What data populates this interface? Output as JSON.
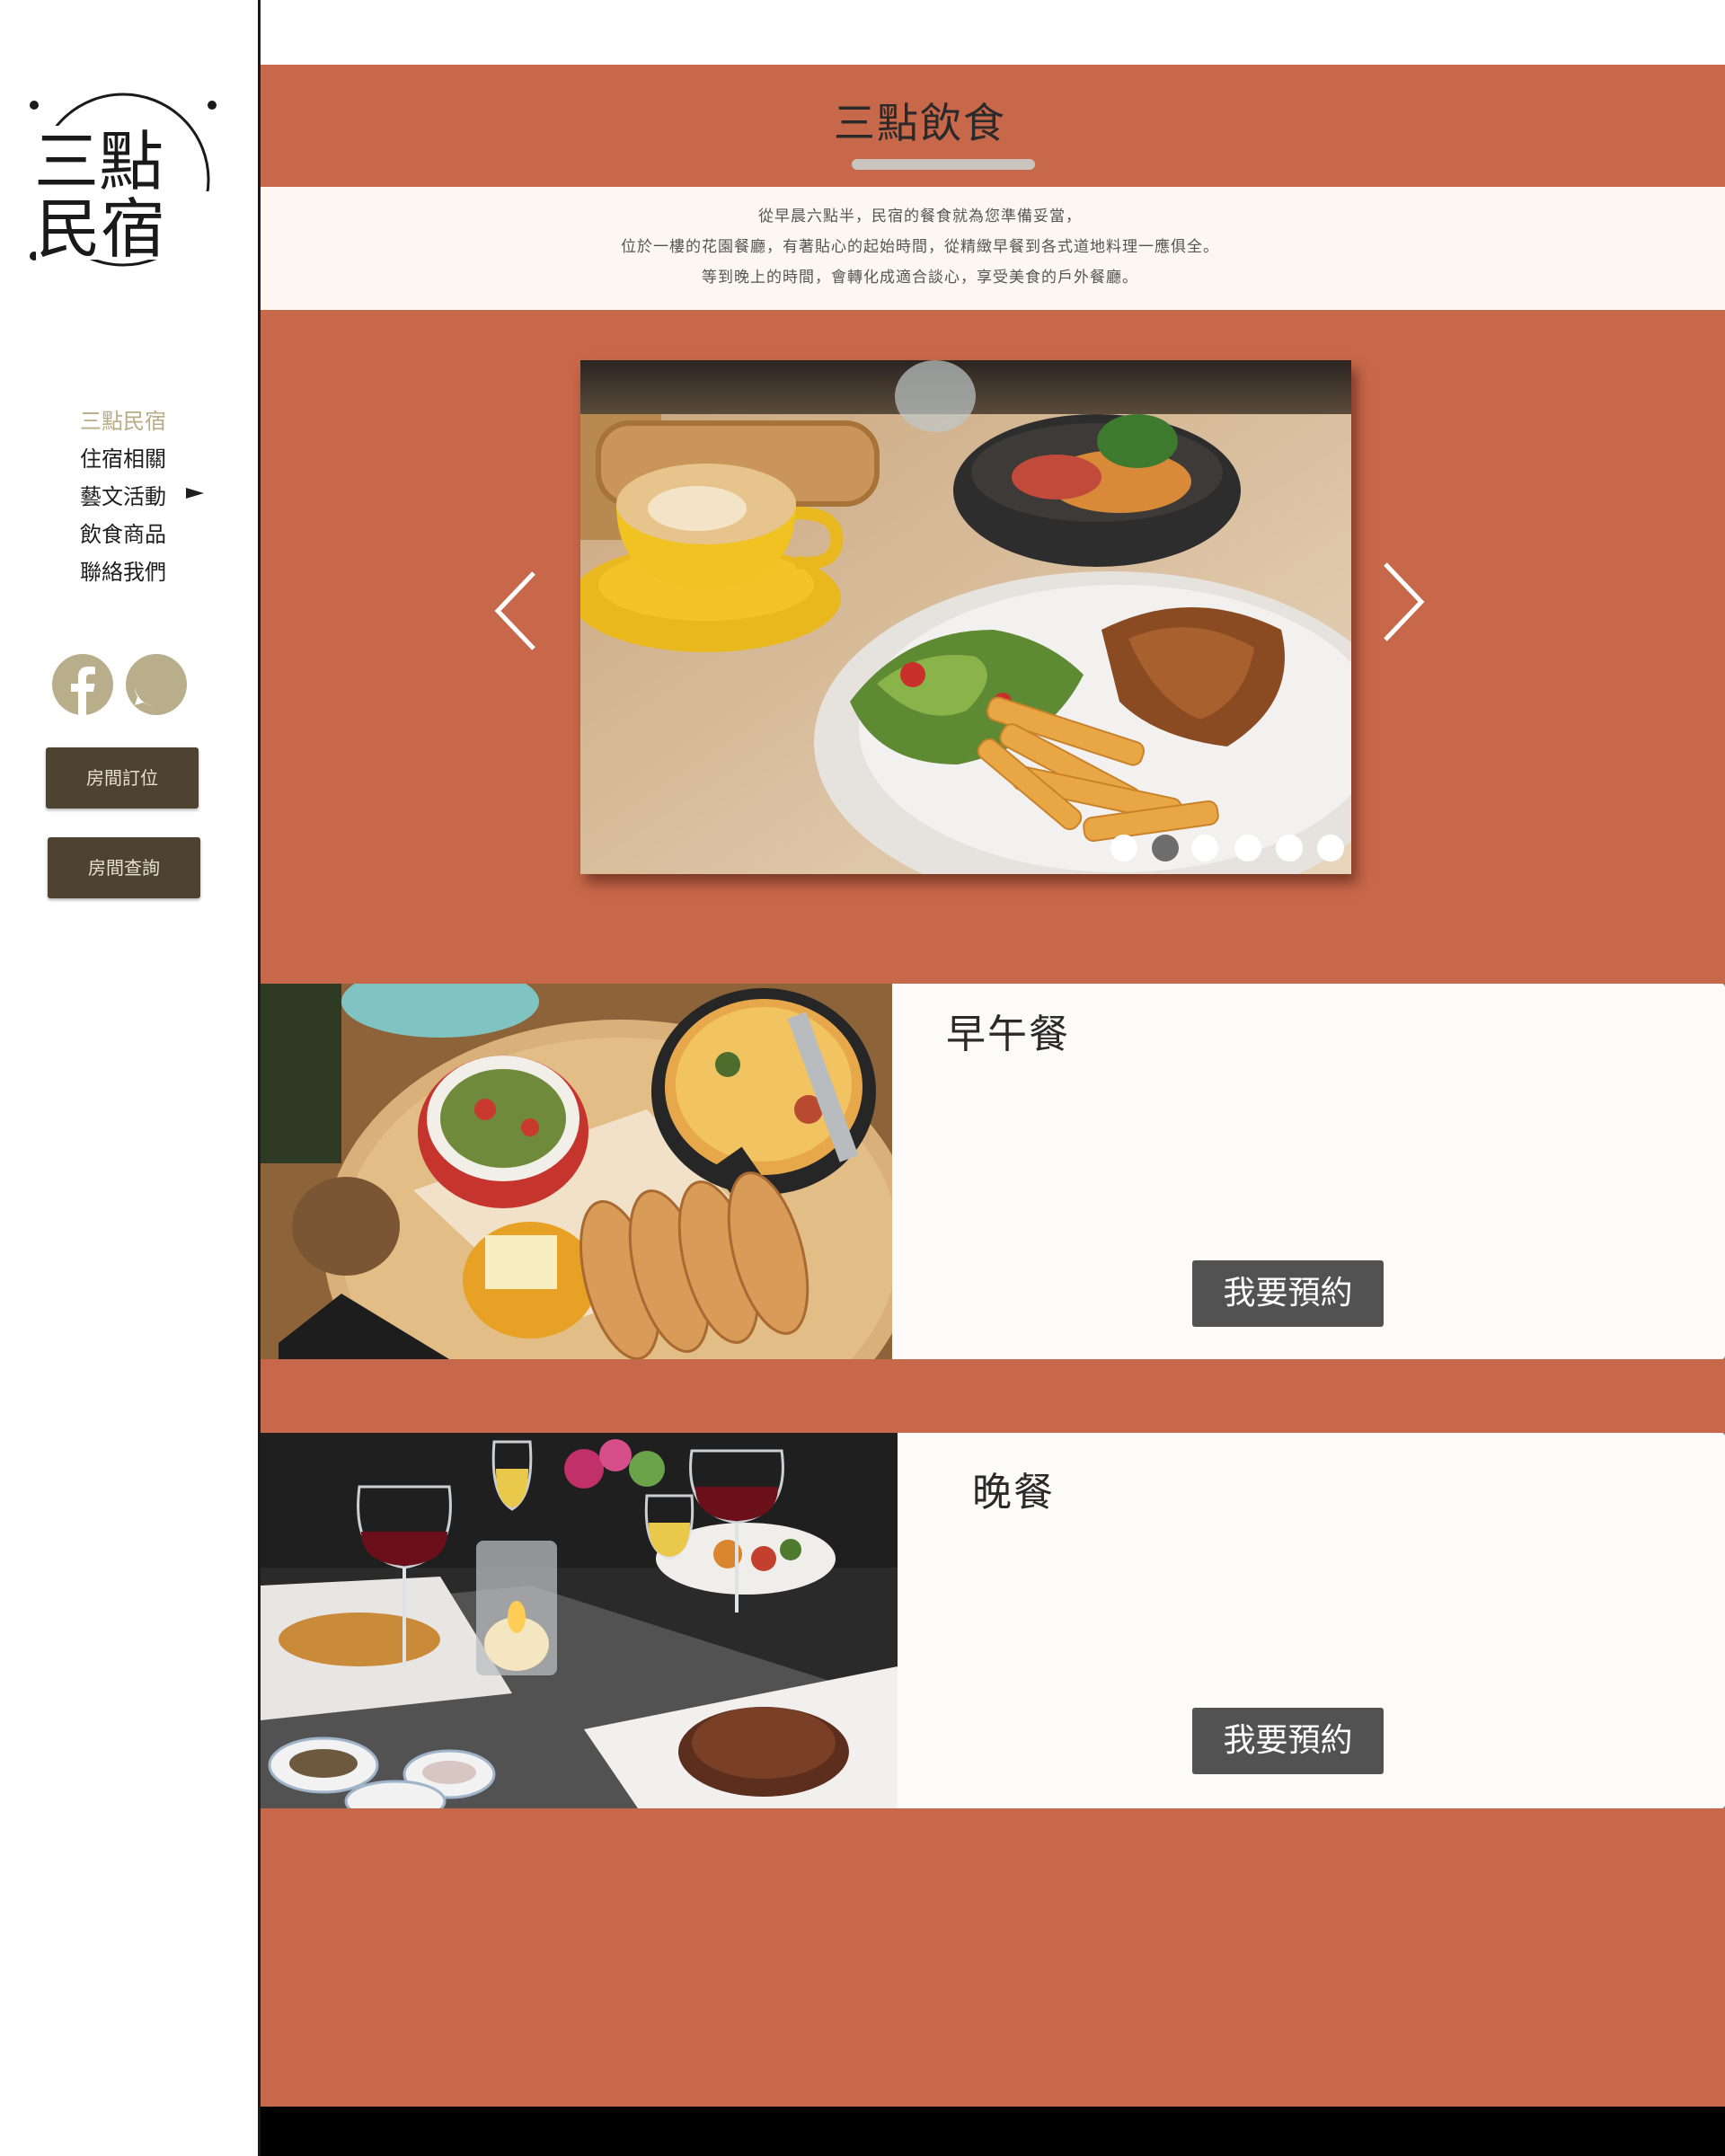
{
  "brand": {
    "logo_text_line1": "三點",
    "logo_text_line2": "民宿"
  },
  "sidebar": {
    "nav": [
      {
        "label": "三點民宿",
        "active": true
      },
      {
        "label": "住宿相關",
        "active": false
      },
      {
        "label": "藝文活動",
        "active": false,
        "has_submenu": true
      },
      {
        "label": "飲食商品",
        "active": false
      },
      {
        "label": "聯絡我們",
        "active": false
      }
    ],
    "social": [
      {
        "icon": "facebook-icon"
      },
      {
        "icon": "whatsapp-icon"
      }
    ],
    "buttons": {
      "booking": "房間訂位",
      "query": "房間查詢"
    }
  },
  "page": {
    "title": "三點飲食",
    "intro": [
      "從早晨六點半，民宿的餐食就為您準備妥當，",
      "位於一樓的花園餐廳，有著貼心的起始時間，從精緻早餐到各式道地料理一應俱全。",
      "等到晚上的時間，會轉化成適合談心，享受美食的戶外餐廳。"
    ]
  },
  "carousel": {
    "slide_count": 6,
    "active_index": 1,
    "prev_icon": "chevron-left-icon",
    "next_icon": "chevron-right-icon"
  },
  "meals": [
    {
      "title": "早午餐",
      "button": "我要預約"
    },
    {
      "title": "晚餐",
      "button": "我要預約"
    }
  ],
  "colors": {
    "accent": "#c8684a",
    "intro_bg": "#fcf7f1",
    "sidebar_button": "#4e4331",
    "nav_active": "#b8ad86",
    "social_icon": "#b9ae8c",
    "reserve_button": "#525252"
  }
}
